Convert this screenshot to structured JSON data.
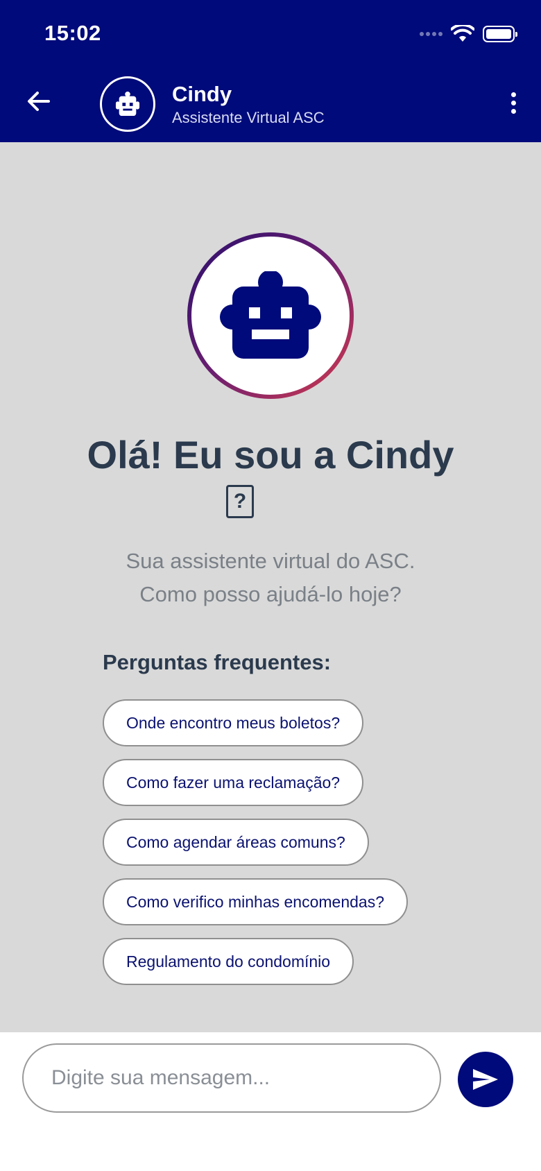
{
  "status_bar": {
    "time": "15:02",
    "icons": [
      "signal-icon",
      "wifi-icon",
      "battery-icon"
    ]
  },
  "header": {
    "back_icon": "arrow-left-icon",
    "avatar_icon": "robot-icon",
    "title": "Cindy",
    "subtitle": "Assistente Virtual ASC",
    "menu_icon": "more-vertical-icon"
  },
  "welcome": {
    "avatar_icon": "robot-icon",
    "greeting": "Olá! Eu sou a Cindy",
    "emoji_placeholder": "?",
    "line1": "Sua assistente virtual do ASC.",
    "line2": "Como posso ajudá-lo hoje?"
  },
  "faq": {
    "title": "Perguntas frequentes:",
    "items": [
      "Onde encontro meus boletos?",
      "Como fazer uma reclamação?",
      "Como agendar áreas comuns?",
      "Como verifico minhas encomendas?",
      "Regulamento do condomínio"
    ]
  },
  "composer": {
    "placeholder": "Digite sua mensagem...",
    "send_icon": "send-icon"
  },
  "colors": {
    "brand": "#000a7a",
    "background": "#d9d9d9",
    "heading": "#2b3a4d",
    "chip_text": "#0b1270"
  }
}
